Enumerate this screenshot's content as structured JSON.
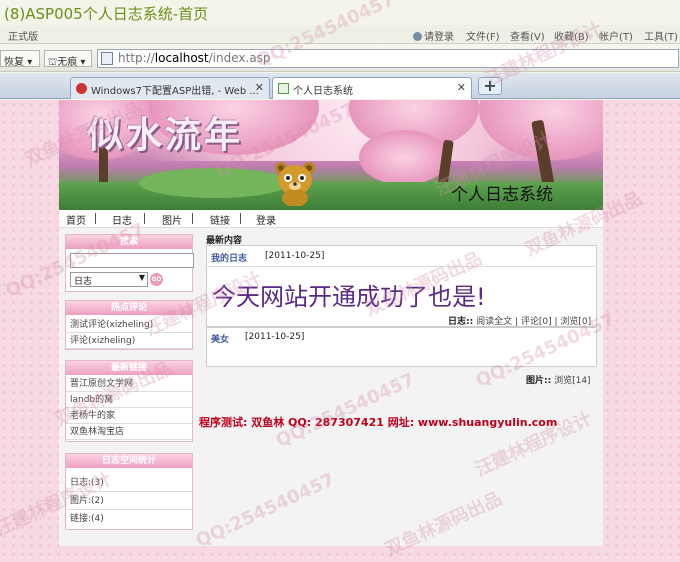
{
  "caption": "(8)ASP005个人日志系统-首页",
  "menubar": {
    "edition": "正式版",
    "items": [
      "请登录",
      "文件(F)",
      "查看(V)",
      "收藏(B)",
      "帐户(T)",
      "工具(T)"
    ]
  },
  "toolbar": {
    "restore_label": "恢复",
    "notrace_label": "无痕",
    "address": {
      "scheme": "http://",
      "host": "localhost",
      "path": "/index.asp"
    }
  },
  "tabs": [
    {
      "label": "Windows7下配置ASP出错, - Web ..."
    },
    {
      "label": "个人日志系统"
    }
  ],
  "newtab_label": "+",
  "site": {
    "logo_text": "似水流年",
    "title": "个人日志系统",
    "nav": [
      "首页",
      "日志",
      "图片",
      "链接",
      "登录"
    ],
    "search": {
      "header": "搜索",
      "selected": "日志",
      "go_label": "GO"
    },
    "hot_comments": {
      "header": "热点评论",
      "items": [
        "测试评论(xizheling)",
        "评论(xizheling)"
      ]
    },
    "links": {
      "header": "最新链接",
      "items": [
        "晋江原创文学网",
        "landb的窝",
        "老杨牛的家",
        "双鱼林淘宝店"
      ]
    },
    "stats": {
      "header": "日志空间统计",
      "items": [
        "日志:(3)",
        "图片:(2)",
        "链接:(4)"
      ]
    },
    "latest_label": "最新内容",
    "posts": [
      {
        "category": "我的日志",
        "date": "[2011-10-25]",
        "content": "今天网站开通成功了也是!"
      },
      {
        "category": "美女",
        "date": "[2011-10-25]"
      }
    ],
    "post_meta": {
      "label": "日志::",
      "read": "阅读全文",
      "comments": "评论[0]",
      "views": "浏览[0]"
    },
    "image_stat": {
      "label": "图片::",
      "views": "浏览[14]"
    },
    "footer": "程序测试: 双鱼林 QQ: 287307421 网址: www.shuangyulin.com"
  },
  "watermark_texts": [
    "QQ:254540457",
    "汪建林程序设计",
    "双鱼林源码出品"
  ],
  "colors": {
    "caption": "#6c8f1a",
    "box_header": "#ee9fc0",
    "post_title": "#5b2a86",
    "footer": "#c0001a",
    "watermark": "#d68caa"
  }
}
